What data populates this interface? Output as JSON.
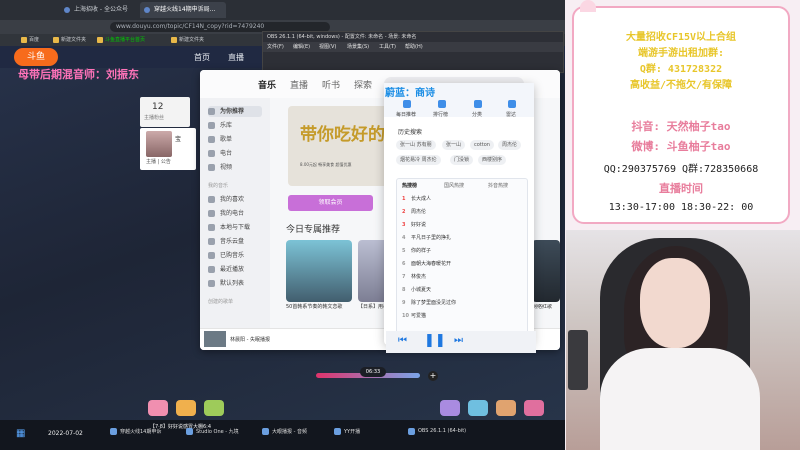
{
  "browser": {
    "tabs": [
      "上海招收 - 全公众号",
      "穿越火线14期申诉局..."
    ],
    "address": "www.douyu.com/topic/CF14N_copy?rid=7479240",
    "bookmarks": [
      "百度",
      "新建文件夹",
      "斗鱼直播平台首页",
      "新建文件夹"
    ]
  },
  "douyu": {
    "logo": "斗鱼",
    "nav": [
      "首页",
      "直播"
    ],
    "caption": "母带后期混音师：刘振东",
    "follow_count": "12",
    "follow_label": "主播粉丝",
    "streamer_name": "宝",
    "streamer_foot": "主播  | 公告"
  },
  "obs": {
    "title": "OBS 26.1.1 (64-bit, windows) - 配置文件: 未命名 - 场景: 未命名",
    "menu": [
      "文件(F)",
      "编辑(E)",
      "视图(V)",
      "场景集(S)",
      "工具(T)",
      "帮助(H)"
    ]
  },
  "player": {
    "tabs": [
      "音乐",
      "直播",
      "听书",
      "探索"
    ],
    "search_text": "蔚蓝：",
    "sidebar": [
      "为你推荐",
      "乐库",
      "歌单",
      "电台",
      "视频"
    ],
    "sidebar_head": "我的音乐",
    "sidebar_mine": [
      "我的喜欢",
      "我的电台",
      "本地与下载",
      "音乐云盘",
      "已购音乐",
      "最近播放",
      "默认列表"
    ],
    "playlist_head": "创建的歌单",
    "banner_title": "带你吃好的",
    "banner_sub": "8.00元起 畅享美食 超值优惠",
    "vip_button": "领取会员",
    "reco_title": "今日专属推荐",
    "card_captions": [
      "50首韩系节奏的韩文恋歌",
      "【日系】用尽全力 声音曙光",
      "网络红歌"
    ],
    "now_playing": "林晨阳 - 失眠播报",
    "time": "06:33"
  },
  "dropdown": {
    "header": "蔚蓝：商诗",
    "quick": [
      "每日推荐",
      "排行榜",
      "分类",
      "雷达"
    ],
    "history_title": "历史搜索",
    "history_chips": [
      "张一山 苏有朋",
      "张一山",
      "cotton",
      "周杰伦",
      "烟花易冷 周杰伦",
      "门没锁",
      "西楼别序"
    ],
    "hot_tabs": [
      "热搜榜",
      "国风热搜",
      "抖音热搜"
    ],
    "hot_list": [
      {
        "n": "1",
        "t": "长大成人"
      },
      {
        "n": "2",
        "t": "周杰伦"
      },
      {
        "n": "3",
        "t": "好好说"
      },
      {
        "n": "4",
        "t": "平凡日子里的挣扎"
      },
      {
        "n": "5",
        "t": "你的样子"
      },
      {
        "n": "6",
        "t": "面朝大海春暖花开"
      },
      {
        "n": "7",
        "t": "林俊杰"
      },
      {
        "n": "8",
        "t": "小城夏天"
      },
      {
        "n": "9",
        "t": "除了梦里面没见过你"
      },
      {
        "n": "10",
        "t": "可爱猫"
      }
    ]
  },
  "taskbar": {
    "date": "2022-07-02",
    "message": "【7·8】好好说感冒大棚6:4",
    "apps": [
      "穿越火线14期申诉",
      "Studio One - 九境",
      "大眼播报 - 音频",
      "YY开播",
      "OBS 26.1.1 (64-bit)"
    ]
  },
  "info": {
    "line1": "大量招收CF15V以上合组",
    "line2": "端游手游出租加群:",
    "line3": "Q群: 431728322",
    "line4": "高收益/不拖欠/有保障",
    "line5": "抖音: 天然柚子tao",
    "line6": "微博: 斗鱼柚子tao",
    "line7": "QQ:290375769  Q群:728350668",
    "line8": "直播时间",
    "line9": "13:30-17:00  18:30-22: 00"
  },
  "colors": {
    "accent": "#1c8ee5",
    "pink": "#e87d9c",
    "gold": "#e8c62a"
  }
}
